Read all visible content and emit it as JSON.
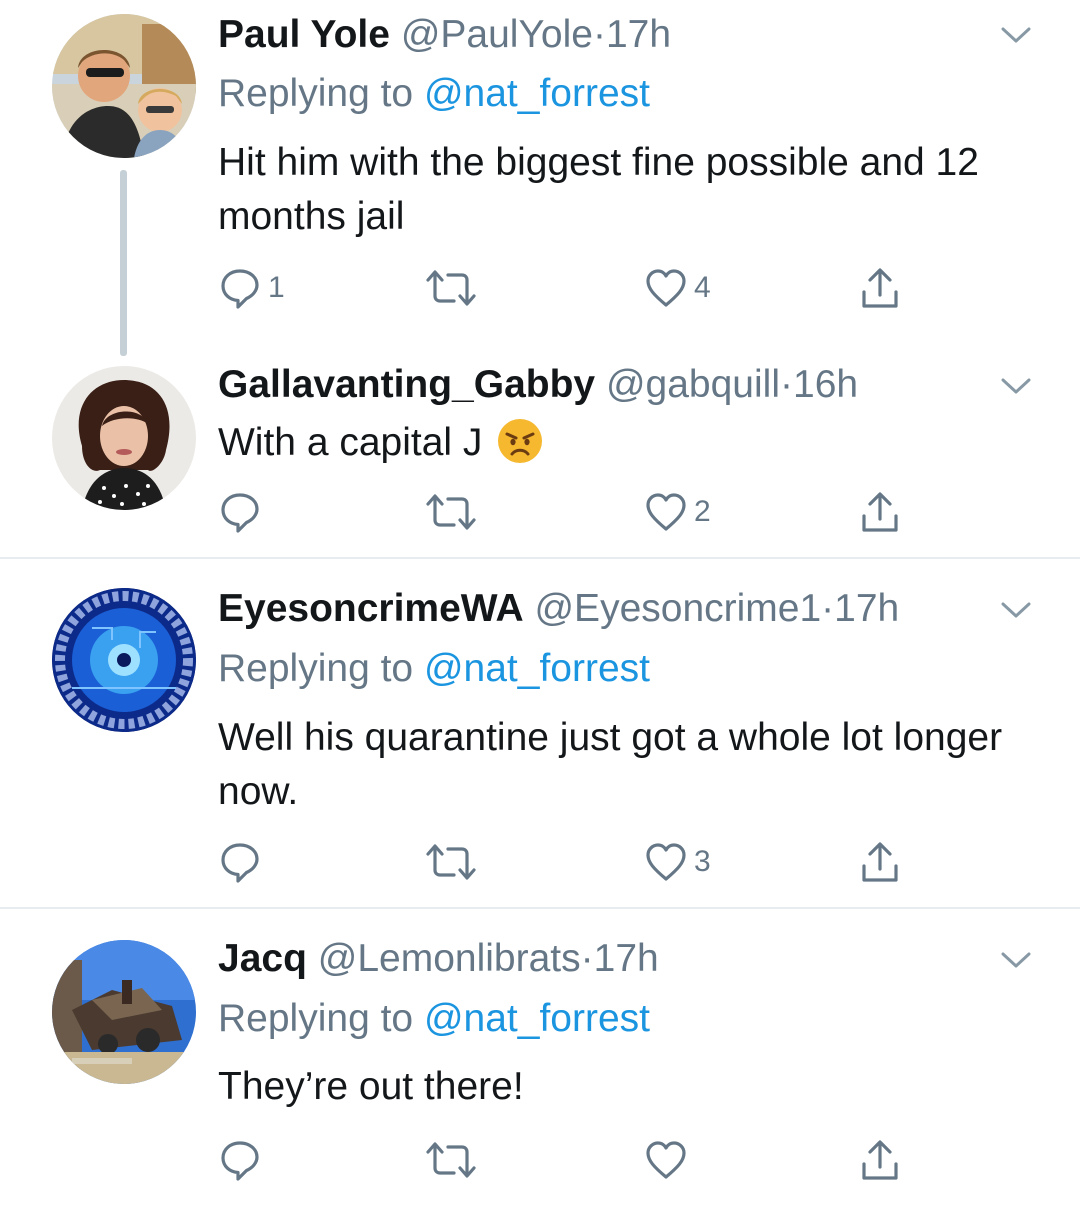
{
  "tweets": [
    {
      "display_name": "Paul Yole",
      "handle": "@PaulYole",
      "dot": "·",
      "time": "17h",
      "replying_prefix": "Replying to ",
      "replying_to": "@nat_forrest",
      "body": "Hit him with the biggest fine possible and 12 months jail",
      "reply_count": "1",
      "retweet_count": "",
      "like_count": "4"
    },
    {
      "display_name": "Gallavanting_Gabby",
      "handle": "@gabquill",
      "dot": "·",
      "time": "16h",
      "body": "With a capital J",
      "body_emoji": "angry-face-emoji",
      "reply_count": "",
      "retweet_count": "",
      "like_count": "2"
    },
    {
      "display_name": "EyesoncrimeWA",
      "handle": "@Eyesoncrime1",
      "dot": "·",
      "time": "17h",
      "replying_prefix": "Replying to ",
      "replying_to": "@nat_forrest",
      "body": "Well his quarantine just got a whole lot longer now.",
      "reply_count": "",
      "retweet_count": "",
      "like_count": "3"
    },
    {
      "display_name": "Jacq",
      "handle": "@Lemonlibrats",
      "dot": "·",
      "time": "17h",
      "replying_prefix": "Replying to ",
      "replying_to": "@nat_forrest",
      "body": "They’re out there!",
      "reply_count": "",
      "retweet_count": "",
      "like_count": ""
    }
  ],
  "icons": {
    "reply": "reply-icon",
    "retweet": "retweet-icon",
    "like": "heart-icon",
    "share": "share-icon",
    "more": "chevron-down-icon"
  },
  "colors": {
    "text": "#14171a",
    "secondary": "#657786",
    "link": "#1b95e0",
    "thread_line": "#c4cfd6",
    "divider": "#e6ecf0"
  }
}
